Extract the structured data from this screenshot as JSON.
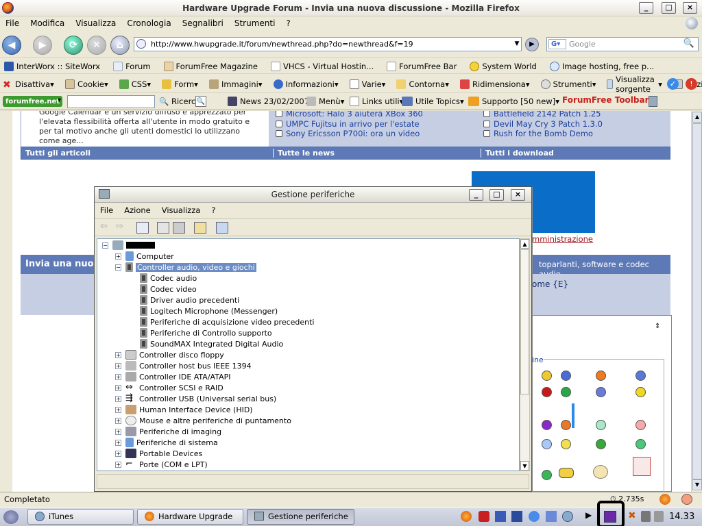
{
  "browser": {
    "title": "Hardware Upgrade Forum - Invia una nuova discussione - Mozilla Firefox",
    "menu": [
      "File",
      "Modifica",
      "Visualizza",
      "Cronologia",
      "Segnalibri",
      "Strumenti",
      "?"
    ],
    "url": "http://www.hwupgrade.it/forum/newthread.php?do=newthread&f=19",
    "search_placeholder": "Google",
    "bookmarks": [
      "InterWorx :: SiteWorx",
      "Forum",
      "ForumFree Magazine",
      "VHCS - Virtual Hostin...",
      "ForumFree Bar",
      "System World",
      "Image hosting, free p..."
    ],
    "webdev_toolbar": [
      "Disattiva",
      "Cookie",
      "CSS",
      "Form",
      "Immagini",
      "Informazioni",
      "Varie",
      "Contorna",
      "Ridimensiona",
      "Strumenti",
      "Visualizza sorgente",
      "Opzioni"
    ],
    "forumfree_toolbar": {
      "logo": "forumfree.net",
      "search": "Ricerca",
      "news": "News 23/02/2007",
      "menu": "Menù",
      "links": "Links utili",
      "topics": "Utile Topics",
      "support": "Supporto [50 new]",
      "brand": "ForumFree Toolbar"
    },
    "status_text": "Completato",
    "status_time": "2.735s"
  },
  "page": {
    "article_text": [
      "Google Calendar è un servizio diffuso e apprezzato per",
      "l'elevata flessibilità offerta all'utente in modo gratuito e",
      "per tal motivo anche gli utenti domestici lo utilizzano",
      "come age..."
    ],
    "news": [
      "Microsoft: Halo 3 aiuterà XBox 360",
      "UMPC Fujitsu in arrivo per l'estate",
      "Sony Ericsson P700i: ora un video"
    ],
    "downloads": [
      "Battlefield 2142 Patch 1.25",
      "Devil May Cry 3 Patch 1.3.0",
      "Rush for the Bomb Demo"
    ],
    "bar_articles": "Tutti gli articoli",
    "bar_news": "Tutte le news",
    "bar_downloads": "Tutti i download",
    "admin_link": "mministrazione",
    "new_thread_header": "Invia una nuo",
    "forum_path": "toparlanti, software e codec audio",
    "welcome": "ome {E}",
    "smilies_legend": "ine"
  },
  "device_manager": {
    "title": "Gestione periferiche",
    "menu": [
      "File",
      "Azione",
      "Visualizza",
      "?"
    ],
    "tree": {
      "computer": "Computer",
      "audio_group": "Controller audio, video e giochi",
      "audio_children": [
        "Codec audio",
        "Codec video",
        "Driver audio precedenti",
        "Logitech Microphone (Messenger)",
        "Periferiche di acquisizione video precedenti",
        "Periferiche di Controllo supporto",
        "SoundMAX Integrated Digital Audio"
      ],
      "other_groups": [
        "Controller disco floppy",
        "Controller host bus IEEE 1394",
        "Controller IDE ATA/ATAPI",
        "Controller SCSI e RAID",
        "Controller USB (Universal serial bus)",
        "Human Interface Device (HID)",
        "Mouse e altre periferiche di puntamento",
        "Periferiche di imaging",
        "Periferiche di sistema",
        "Portable Devices",
        "Porte (COM e LPT)"
      ]
    }
  },
  "taskbar": {
    "tasks": [
      "iTunes",
      "Hardware Upgrade F...",
      "Gestione periferiche"
    ],
    "clock": "14.33"
  }
}
